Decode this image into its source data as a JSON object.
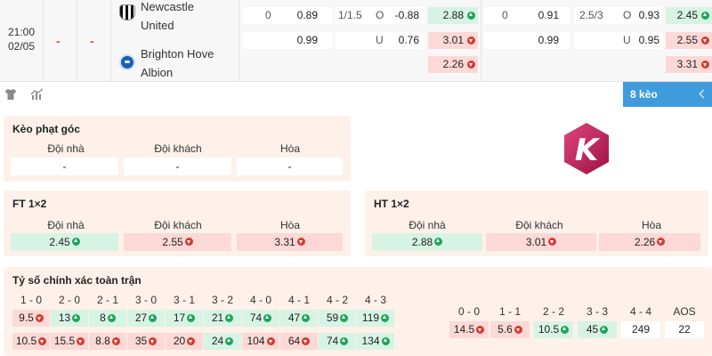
{
  "match": {
    "time": "21:00",
    "date": "02/05",
    "score_home": "-",
    "score_away": "-",
    "home_team": [
      "Newcastle",
      "United"
    ],
    "away_team": [
      "Brighton Hove",
      "Albion"
    ]
  },
  "ft_odds": {
    "handicap": {
      "home_line": "0",
      "home": "0.89",
      "away": "0.99"
    },
    "over_under": {
      "line": "1/1.5",
      "over_label": "O",
      "over": "-0.88",
      "under_label": "U",
      "under": "0.76"
    },
    "x12": [
      {
        "value": "2.88",
        "dir": "up"
      },
      {
        "value": "3.01",
        "dir": "down"
      },
      {
        "value": "2.26",
        "dir": "down"
      }
    ]
  },
  "ht_odds": {
    "handicap": {
      "home_line": "0",
      "home": "0.91",
      "away": "0.99"
    },
    "over_under": {
      "line": "2.5/3",
      "over_label": "O",
      "over": "0.93",
      "under_label": "U",
      "under": "0.95"
    },
    "x12": [
      {
        "value": "2.45",
        "dir": "up"
      },
      {
        "value": "2.55",
        "dir": "down"
      },
      {
        "value": "3.31",
        "dir": "down"
      }
    ]
  },
  "toolbar": {
    "icons": [
      "shirt-icon",
      "stats-icon"
    ],
    "more_label": "8 kèo"
  },
  "corner": {
    "title": "Kèo phạt góc",
    "headers": [
      "Đội nhà",
      "Đội khách",
      "Hòa"
    ],
    "values": [
      "-",
      "-",
      "-"
    ]
  },
  "ft_1x2": {
    "title": "FT 1×2",
    "headers": [
      "Đội nhà",
      "Đội khách",
      "Hòa"
    ],
    "values": [
      {
        "value": "2.45",
        "dir": "up"
      },
      {
        "value": "2.55",
        "dir": "down"
      },
      {
        "value": "3.31",
        "dir": "down"
      }
    ]
  },
  "ht_1x2": {
    "title": "HT 1×2",
    "headers": [
      "Đội nhà",
      "Đội khách",
      "Hòa"
    ],
    "values": [
      {
        "value": "2.88",
        "dir": "up"
      },
      {
        "value": "3.01",
        "dir": "down"
      },
      {
        "value": "2.26",
        "dir": "down"
      }
    ]
  },
  "correct_score": {
    "title": "Tỷ số chính xác toàn trận",
    "home_win": [
      {
        "score": "1 - 0",
        "home": "9.5",
        "home_dir": "down",
        "away": "10.5",
        "away_dir": "down"
      },
      {
        "score": "2 - 0",
        "home": "13",
        "home_dir": "up",
        "away": "15.5",
        "away_dir": "down"
      },
      {
        "score": "2 - 1",
        "home": "8",
        "home_dir": "up",
        "away": "8.8",
        "away_dir": "down"
      },
      {
        "score": "3 - 0",
        "home": "27",
        "home_dir": "up",
        "away": "35",
        "away_dir": "down"
      },
      {
        "score": "3 - 1",
        "home": "17",
        "home_dir": "up",
        "away": "20",
        "away_dir": "down"
      },
      {
        "score": "3 - 2",
        "home": "21",
        "home_dir": "up",
        "away": "24",
        "away_dir": "up"
      },
      {
        "score": "4 - 0",
        "home": "74",
        "home_dir": "up",
        "away": "104",
        "away_dir": "down"
      },
      {
        "score": "4 - 1",
        "home": "47",
        "home_dir": "up",
        "away": "64",
        "away_dir": "down"
      },
      {
        "score": "4 - 2",
        "home": "59",
        "home_dir": "up",
        "away": "74",
        "away_dir": "up"
      },
      {
        "score": "4 - 3",
        "home": "119",
        "home_dir": "up",
        "away": "134",
        "away_dir": "up"
      }
    ],
    "draws": [
      {
        "score": "0 - 0",
        "value": "14.5",
        "dir": "down"
      },
      {
        "score": "1 - 1",
        "value": "5.6",
        "dir": "down"
      },
      {
        "score": "2 - 2",
        "value": "10.5",
        "dir": "up"
      },
      {
        "score": "3 - 3",
        "value": "45",
        "dir": "up"
      },
      {
        "score": "4 - 4",
        "value": "249",
        "dir": "none"
      },
      {
        "score": "AOS",
        "value": "22",
        "dir": "none"
      }
    ]
  },
  "colors": {
    "accent": "#3f9bdc",
    "up": "#1fa45a",
    "down": "#d93a2f",
    "card_bg": "#fdf1ea",
    "logo": "#c2185b"
  },
  "logo": {
    "letter": "K"
  }
}
